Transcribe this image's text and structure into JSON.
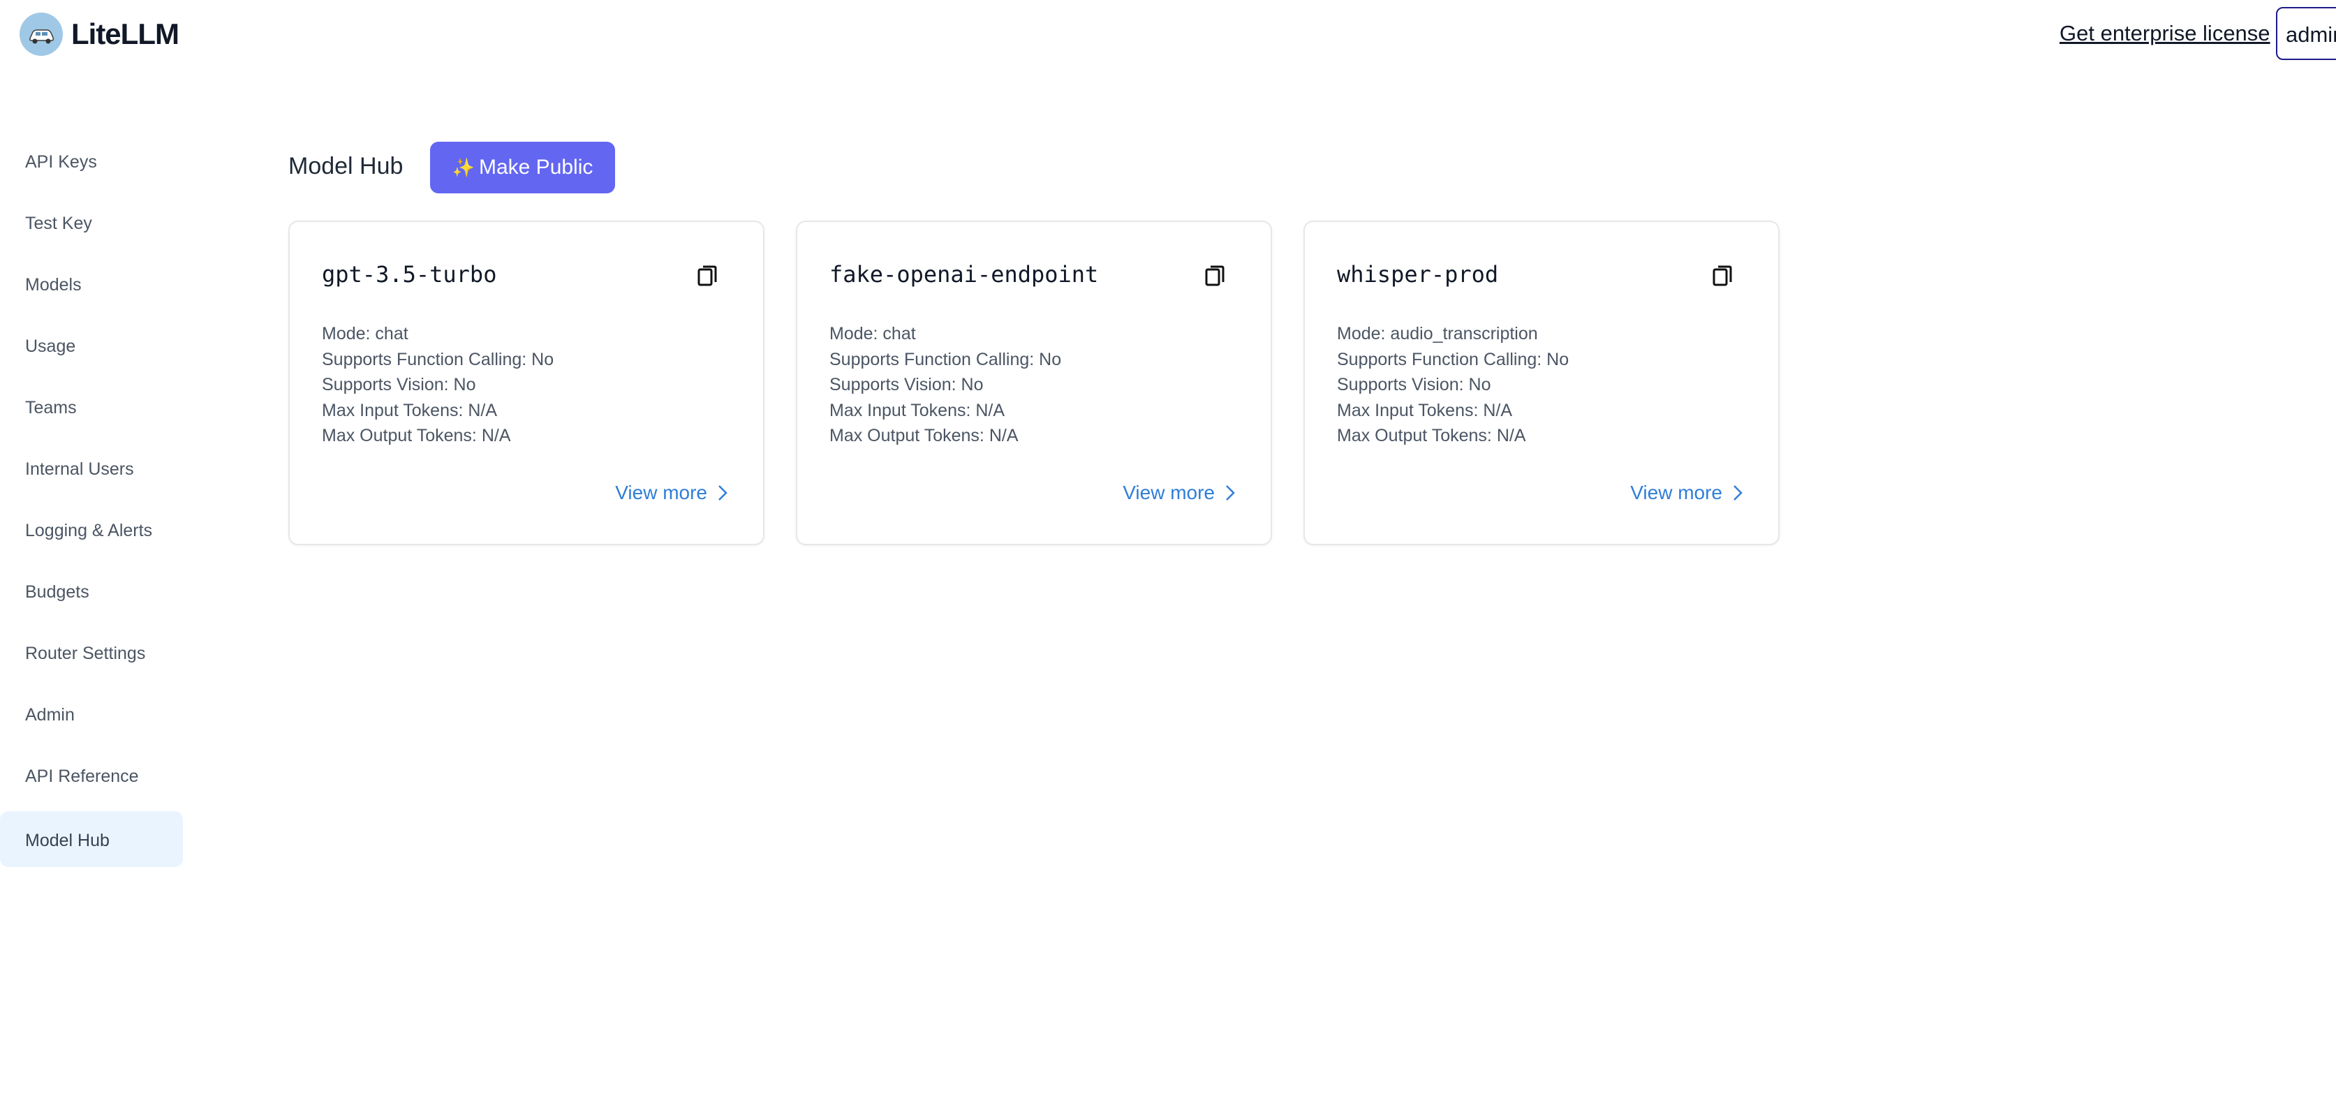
{
  "app": {
    "name": "LiteLLM",
    "logo_icon": "litellm-logo-icon"
  },
  "header": {
    "enterprise_link": "Get enterprise license",
    "user_button": "admin"
  },
  "sidebar": {
    "items": [
      {
        "label": "API Keys"
      },
      {
        "label": "Test Key"
      },
      {
        "label": "Models"
      },
      {
        "label": "Usage"
      },
      {
        "label": "Teams"
      },
      {
        "label": "Internal Users"
      },
      {
        "label": "Logging & Alerts"
      },
      {
        "label": "Budgets"
      },
      {
        "label": "Router Settings"
      },
      {
        "label": "Admin"
      },
      {
        "label": "API Reference"
      },
      {
        "label": "Model Hub",
        "active": true
      }
    ]
  },
  "main": {
    "title": "Model Hub",
    "make_public_label": "Make Public",
    "make_public_icon": "✨",
    "accent_color": "#6366f1",
    "link_color": "#2f7ed8",
    "cards": [
      {
        "model": "gpt-3.5-turbo",
        "mode": "Mode: chat",
        "function_calling": "Supports Function Calling: No",
        "vision": "Supports Vision: No",
        "max_input": "Max Input Tokens: N/A",
        "max_output": "Max Output Tokens: N/A",
        "view_more": "View more"
      },
      {
        "model": "fake-openai-endpoint",
        "mode": "Mode: chat",
        "function_calling": "Supports Function Calling: No",
        "vision": "Supports Vision: No",
        "max_input": "Max Input Tokens: N/A",
        "max_output": "Max Output Tokens: N/A",
        "view_more": "View more"
      },
      {
        "model": "whisper-prod",
        "mode": "Mode: audio_transcription",
        "function_calling": "Supports Function Calling: No",
        "vision": "Supports Vision: No",
        "max_input": "Max Input Tokens: N/A",
        "max_output": "Max Output Tokens: N/A",
        "view_more": "View more"
      }
    ]
  }
}
